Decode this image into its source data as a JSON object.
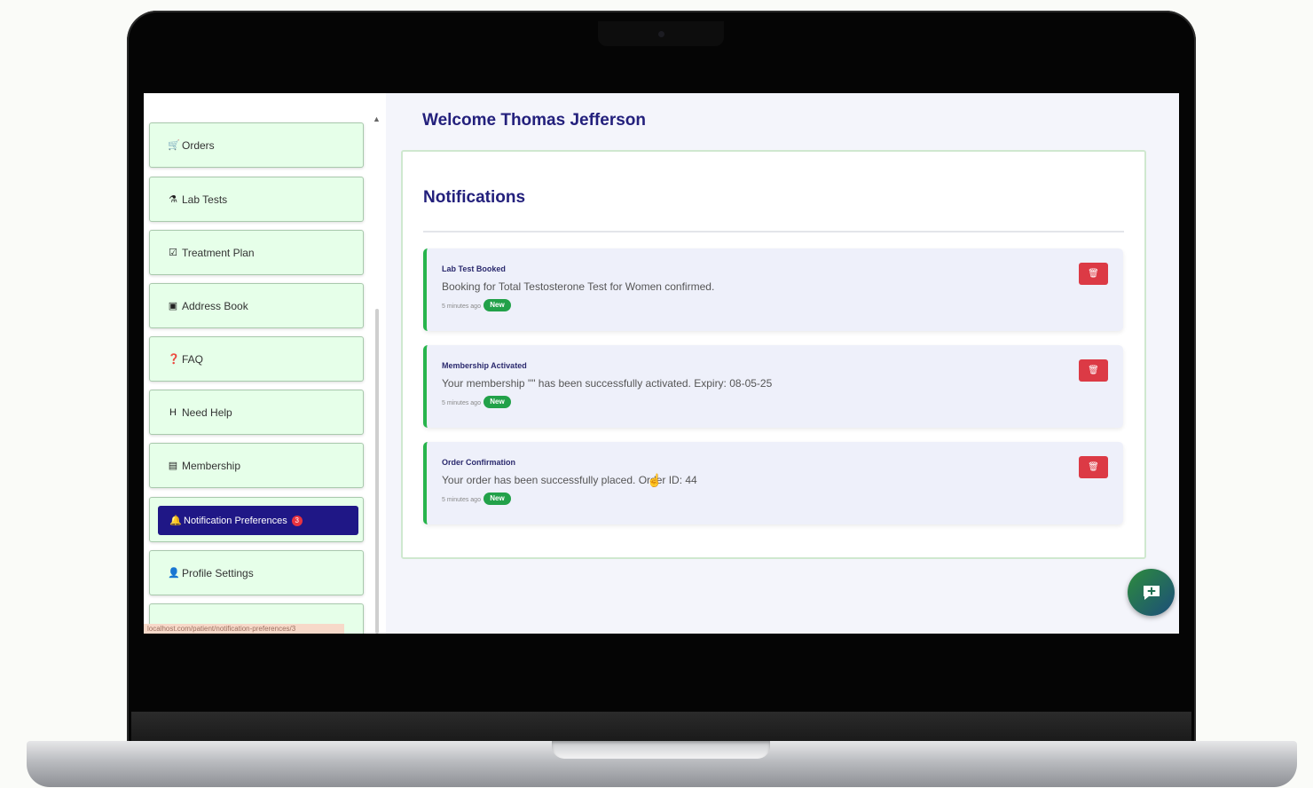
{
  "sidebar": {
    "items": [
      {
        "icon": "🛒",
        "label": "Orders"
      },
      {
        "icon": "⚗",
        "label": "Lab Tests"
      },
      {
        "icon": "☑",
        "label": "Treatment Plan"
      },
      {
        "icon": "▣",
        "label": "Address Book"
      },
      {
        "icon": "❓",
        "label": "FAQ"
      },
      {
        "icon": "H",
        "label": "Need Help"
      },
      {
        "icon": "▤",
        "label": "Membership"
      },
      {
        "icon": "🔔",
        "label": "Notification Preferences",
        "badge": "3"
      },
      {
        "icon": "👤",
        "label": "Profile Settings"
      }
    ],
    "status_url": "localhost.com/patient/notification-preferences/3"
  },
  "header": {
    "welcome": "Welcome Thomas Jefferson"
  },
  "notifications": {
    "title": "Notifications",
    "delete_icon": "trash-icon",
    "items": [
      {
        "title": "Lab Test Booked",
        "message": "Booking for Total Testosterone Test for Women confirmed.",
        "time": "5 minutes ago",
        "badge": "New"
      },
      {
        "title": "Membership Activated",
        "message": "Your membership \"\" has been successfully activated. Expiry: 08-05-25",
        "time": "5 minutes ago",
        "badge": "New"
      },
      {
        "title": "Order Confirmation",
        "message": "Your order has been successfully placed. Order ID: 44",
        "time": "5 minutes ago",
        "badge": "New"
      }
    ]
  },
  "colors": {
    "accent": "#1f1786",
    "heading": "#23207c",
    "menu_bg": "#e6ffe9",
    "success": "#22a149",
    "danger": "#dc3a45"
  }
}
